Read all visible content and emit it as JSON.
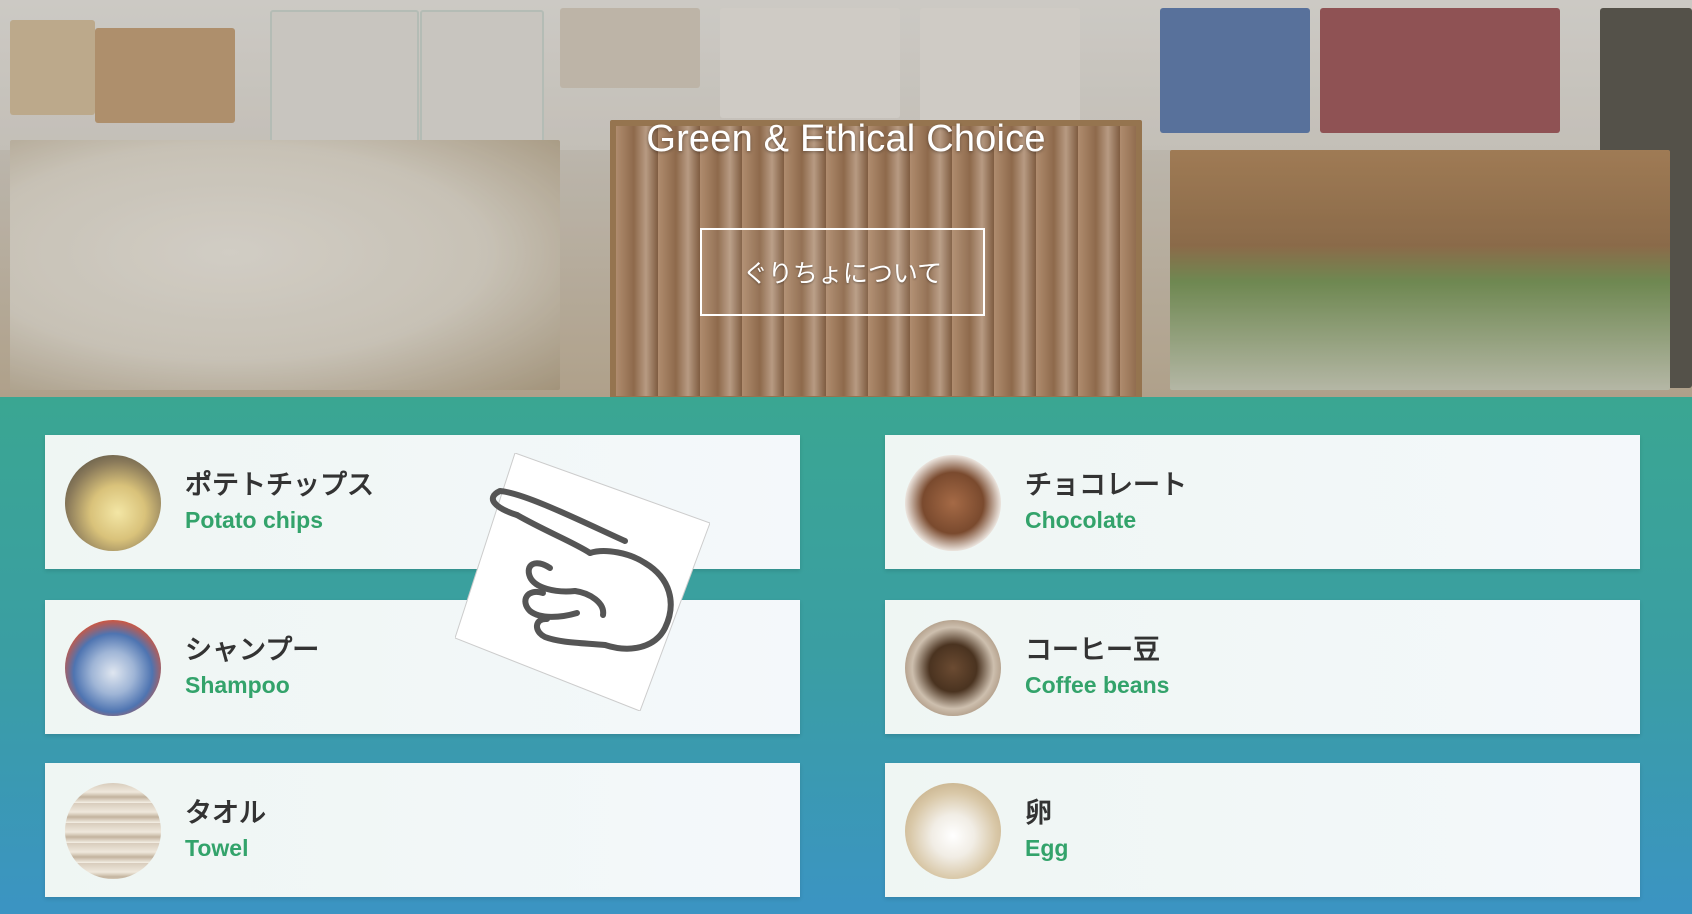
{
  "hero": {
    "title": "Green & Ethical Choice",
    "about_button_label": "ぐりちょについて"
  },
  "products": [
    {
      "jp": "ポテトチップス",
      "en": "Potato chips",
      "thumb_icon": "potato-chips-thumbnail"
    },
    {
      "jp": "チョコレート",
      "en": "Chocolate",
      "thumb_icon": "chocolate-thumbnail"
    },
    {
      "jp": "シャンプー",
      "en": "Shampoo",
      "thumb_icon": "shampoo-thumbnail"
    },
    {
      "jp": "コーヒー豆",
      "en": "Coffee beans",
      "thumb_icon": "coffee-beans-thumbnail"
    },
    {
      "jp": "タオル",
      "en": "Towel",
      "thumb_icon": "towel-thumbnail"
    },
    {
      "jp": "卵",
      "en": "Egg",
      "thumb_icon": "egg-thumbnail"
    }
  ],
  "colors": {
    "product_band_top": "#3aa692",
    "product_band_bottom": "#3b94c3",
    "english_label": "#33a36b",
    "japanese_label": "#333333"
  }
}
